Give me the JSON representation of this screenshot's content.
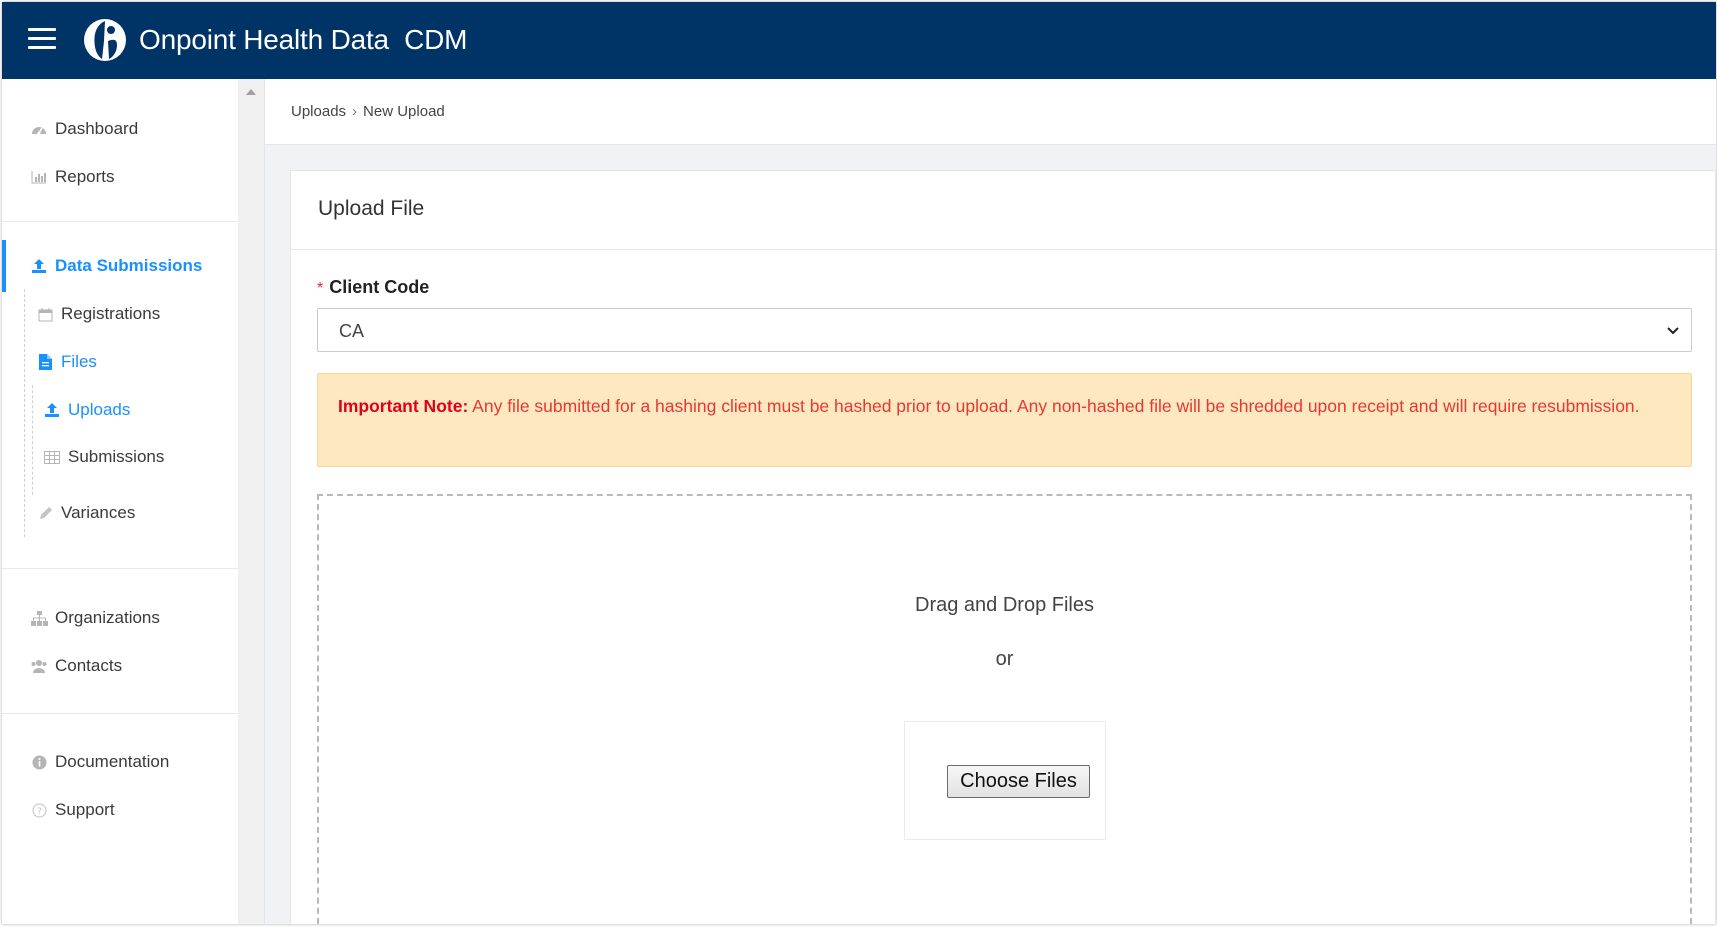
{
  "header": {
    "app_title": "Onpoint Health Data  CDM",
    "bg_color": "#003366"
  },
  "sidebar": {
    "items": [
      {
        "label": "Dashboard",
        "icon": "dashboard-icon"
      },
      {
        "label": "Reports",
        "icon": "bar-chart-icon"
      },
      {
        "label": "Data Submissions",
        "icon": "upload-icon",
        "active": true
      },
      {
        "label": "Registrations",
        "icon": "calendar-icon"
      },
      {
        "label": "Files",
        "icon": "file-icon"
      },
      {
        "label": "Uploads",
        "icon": "upload-icon",
        "selected": true
      },
      {
        "label": "Submissions",
        "icon": "table-icon"
      },
      {
        "label": "Variances",
        "icon": "pencil-icon"
      },
      {
        "label": "Organizations",
        "icon": "org-chart-icon"
      },
      {
        "label": "Contacts",
        "icon": "users-icon"
      },
      {
        "label": "Documentation",
        "icon": "info-icon"
      },
      {
        "label": "Support",
        "icon": "help-icon"
      }
    ],
    "accent_color": "#1890ff"
  },
  "breadcrumb": {
    "items": [
      "Uploads",
      "New Upload"
    ],
    "separator": "›"
  },
  "card": {
    "title": "Upload File",
    "client_code": {
      "required_mark": "*",
      "label": "Client Code",
      "value": "CA"
    },
    "alert": {
      "bold": "Important Note:",
      "text": " Any file submitted for a hashing client must be hashed prior to upload. Any non-hashed file will be shredded upon receipt and will require resubmission."
    },
    "dropzone": {
      "heading": "Drag and Drop Files",
      "or": "or",
      "button": "Choose Files"
    }
  }
}
